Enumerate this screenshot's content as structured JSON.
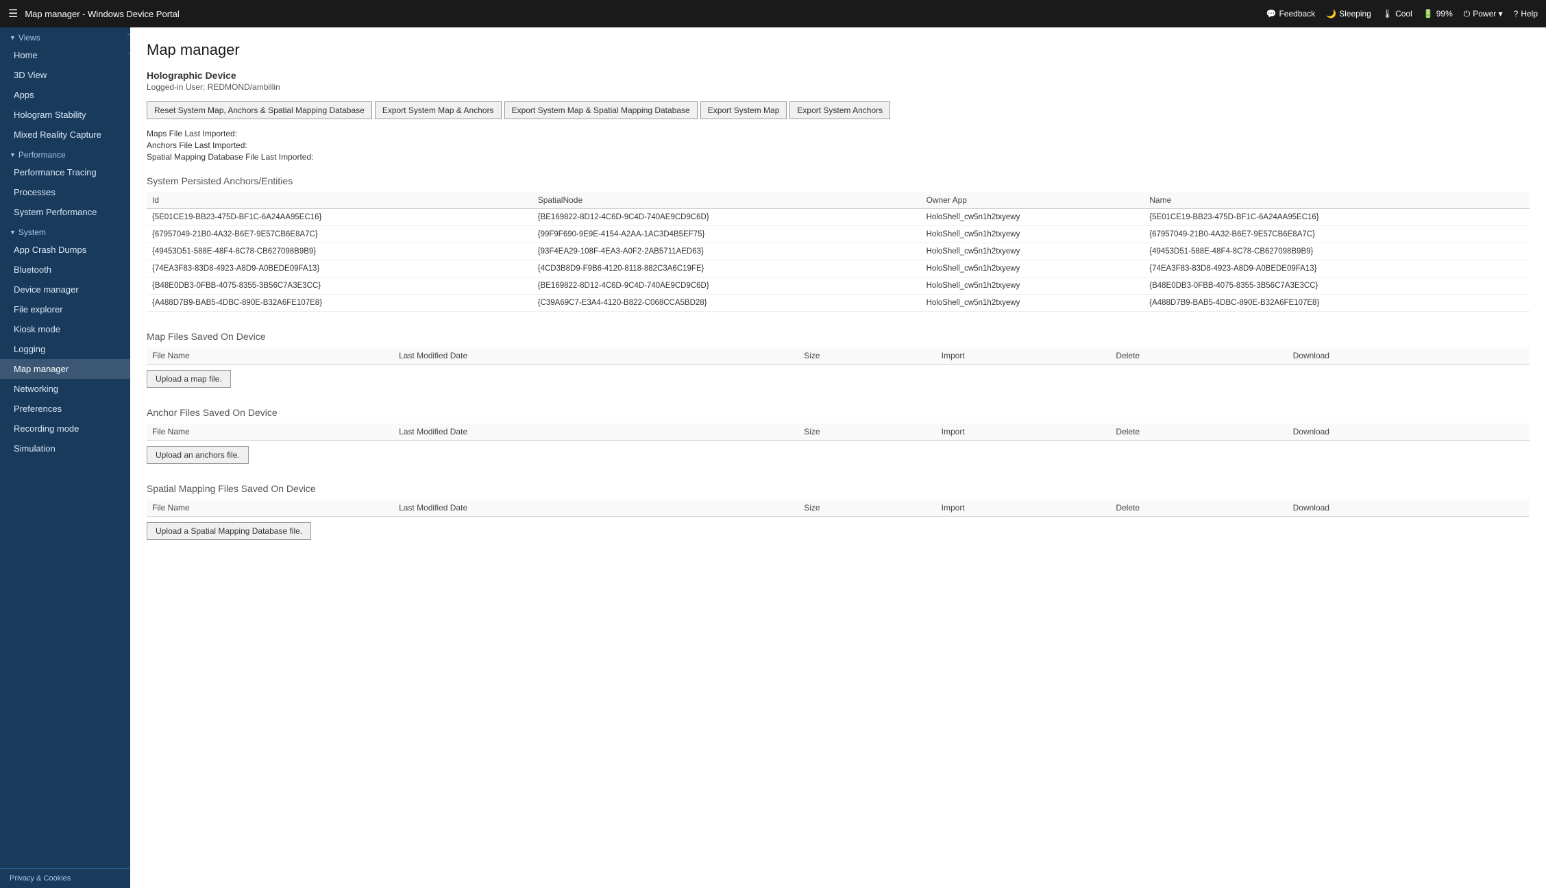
{
  "titlebar": {
    "hamburger": "☰",
    "title": "Map manager - Windows Device Portal",
    "actions": [
      {
        "id": "feedback",
        "icon": "💬",
        "label": "Feedback"
      },
      {
        "id": "sleeping",
        "icon": "🌙",
        "label": "Sleeping"
      },
      {
        "id": "cool",
        "icon": "🌡",
        "label": "Cool"
      },
      {
        "id": "battery",
        "icon": "🔋",
        "label": "99%"
      },
      {
        "id": "power",
        "icon": "⏻",
        "label": "Power ▾"
      },
      {
        "id": "help",
        "icon": "?",
        "label": "Help"
      }
    ]
  },
  "sidebar": {
    "collapse_icon": "❮",
    "sections": [
      {
        "id": "views",
        "label": "Views",
        "items": [
          {
            "id": "home",
            "label": "Home"
          },
          {
            "id": "3dview",
            "label": "3D View"
          },
          {
            "id": "apps",
            "label": "Apps"
          },
          {
            "id": "hologram-stability",
            "label": "Hologram Stability"
          },
          {
            "id": "mixed-reality-capture",
            "label": "Mixed Reality Capture"
          }
        ]
      },
      {
        "id": "performance",
        "label": "Performance",
        "items": [
          {
            "id": "performance-tracing",
            "label": "Performance Tracing"
          },
          {
            "id": "processes",
            "label": "Processes"
          },
          {
            "id": "system-performance",
            "label": "System Performance"
          }
        ]
      },
      {
        "id": "system",
        "label": "System",
        "items": [
          {
            "id": "app-crash-dumps",
            "label": "App Crash Dumps"
          },
          {
            "id": "bluetooth",
            "label": "Bluetooth"
          },
          {
            "id": "device-manager",
            "label": "Device manager"
          },
          {
            "id": "file-explorer",
            "label": "File explorer"
          },
          {
            "id": "kiosk-mode",
            "label": "Kiosk mode"
          },
          {
            "id": "logging",
            "label": "Logging"
          },
          {
            "id": "map-manager",
            "label": "Map manager",
            "active": true
          },
          {
            "id": "networking",
            "label": "Networking"
          },
          {
            "id": "preferences",
            "label": "Preferences"
          },
          {
            "id": "recording-mode",
            "label": "Recording mode"
          },
          {
            "id": "simulation",
            "label": "Simulation"
          }
        ]
      }
    ],
    "bottom_label": "Privacy & Cookies"
  },
  "page": {
    "title": "Map manager",
    "device_name": "Holographic Device",
    "user_info": "Logged-in User: REDMOND/ambillin",
    "buttons": [
      {
        "id": "reset-btn",
        "label": "Reset System Map, Anchors & Spatial Mapping Database"
      },
      {
        "id": "export-map-anchors-btn",
        "label": "Export System Map & Anchors"
      },
      {
        "id": "export-map-spatial-btn",
        "label": "Export System Map & Spatial Mapping Database"
      },
      {
        "id": "export-map-btn",
        "label": "Export System Map"
      },
      {
        "id": "export-anchors-btn",
        "label": "Export System Anchors"
      }
    ],
    "info_lines": [
      {
        "id": "maps-file",
        "label": "Maps File Last Imported:"
      },
      {
        "id": "anchors-file",
        "label": "Anchors File Last Imported:"
      },
      {
        "id": "spatial-file",
        "label": "Spatial Mapping Database File Last Imported:"
      }
    ],
    "anchors_section_title": "System Persisted Anchors/Entities",
    "anchors_table": {
      "columns": [
        "Id",
        "SpatialNode",
        "Owner App",
        "Name"
      ],
      "rows": [
        {
          "id": "{5E01CE19-BB23-475D-BF1C-6A24AA95EC16}",
          "spatialNode": "{BE169822-8D12-4C6D-9C4D-740AE9CD9C6D}",
          "ownerApp": "HoloShell_cw5n1h2txyewy",
          "name": "{5E01CE19-BB23-475D-BF1C-6A24AA95EC16}"
        },
        {
          "id": "{67957049-21B0-4A32-B6E7-9E57CB6E8A7C}",
          "spatialNode": "{99F9F690-9E9E-4154-A2AA-1AC3D4B5EF75}",
          "ownerApp": "HoloShell_cw5n1h2txyewy",
          "name": "{67957049-21B0-4A32-B6E7-9E57CB6E8A7C}"
        },
        {
          "id": "{49453D51-588E-48F4-8C78-CB627098B9B9}",
          "spatialNode": "{93F4EA29-108F-4EA3-A0F2-2AB5711AED63}",
          "ownerApp": "HoloShell_cw5n1h2txyewy",
          "name": "{49453D51-588E-48F4-8C78-CB627098B9B9}"
        },
        {
          "id": "{74EA3F83-83D8-4923-A8D9-A0BEDE09FA13}",
          "spatialNode": "{4CD3B8D9-F9B6-4120-8118-882C3A6C19FE}",
          "ownerApp": "HoloShell_cw5n1h2txyewy",
          "name": "{74EA3F83-83D8-4923-A8D9-A0BEDE09FA13}"
        },
        {
          "id": "{B48E0DB3-0FBB-4075-8355-3B56C7A3E3CC}",
          "spatialNode": "{BE169822-8D12-4C6D-9C4D-740AE9CD9C6D}",
          "ownerApp": "HoloShell_cw5n1h2txyewy",
          "name": "{B48E0DB3-0FBB-4075-8355-3B56C7A3E3CC}"
        },
        {
          "id": "{A488D7B9-BAB5-4DBC-890E-B32A6FE107E8}",
          "spatialNode": "{C39A69C7-E3A4-4120-B822-C068CCA5BD28}",
          "ownerApp": "HoloShell_cw5n1h2txyewy",
          "name": "{A488D7B9-BAB5-4DBC-890E-B32A6FE107E8}"
        }
      ]
    },
    "map_files_section": {
      "title": "Map Files Saved On Device",
      "columns": [
        "File Name",
        "Last Modified Date",
        "Size",
        "Import",
        "Delete",
        "Download"
      ],
      "upload_label": "Upload a map file."
    },
    "anchor_files_section": {
      "title": "Anchor Files Saved On Device",
      "columns": [
        "File Name",
        "Last Modified Date",
        "Size",
        "Import",
        "Delete",
        "Download"
      ],
      "upload_label": "Upload an anchors file."
    },
    "spatial_mapping_section": {
      "title": "Spatial Mapping Files Saved On Device",
      "columns": [
        "File Name",
        "Last Modified Date",
        "Size",
        "Import",
        "Delete",
        "Download"
      ],
      "upload_label": "Upload a Spatial Mapping Database file."
    }
  }
}
